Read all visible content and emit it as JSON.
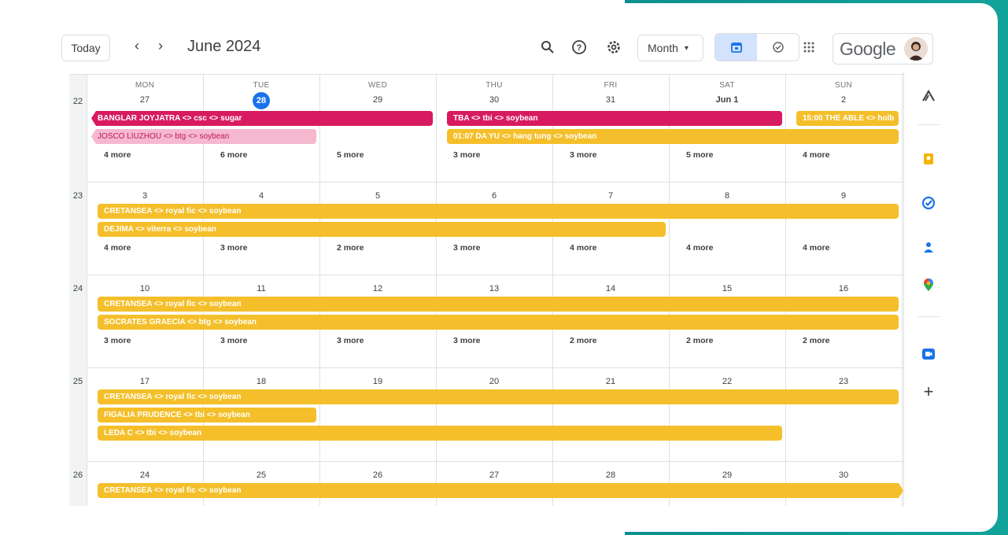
{
  "toolbar": {
    "today_label": "Today",
    "prev_icon": "chevron-left-icon",
    "prev_glyph": "‹",
    "next_icon": "chevron-right-icon",
    "next_glyph": "›",
    "month_title": "June 2024",
    "view_select": "Month",
    "view_select_caret": "▾",
    "brand": "Google"
  },
  "calendar": {
    "headers": [
      {
        "dow": "MON",
        "num": "27"
      },
      {
        "dow": "TUE",
        "num": "28"
      },
      {
        "dow": "WED",
        "num": "29"
      },
      {
        "dow": "THU",
        "num": "30"
      },
      {
        "dow": "FRI",
        "num": "31"
      },
      {
        "dow": "SAT",
        "num": "Jun 1"
      },
      {
        "dow": "SUN",
        "num": "2"
      }
    ],
    "weeks": [
      {
        "week": "22",
        "days": [
          "27",
          "28",
          "29",
          "30",
          "31",
          "Jun 1",
          "2"
        ],
        "more": [
          "4 more",
          "6 more",
          "5 more",
          "3 more",
          "3 more",
          "5 more",
          "4 more"
        ],
        "events": [
          {
            "title": "BANGLAR JOYJATRA <> csc <> sugar",
            "start": 0,
            "span": 3,
            "lane": 0,
            "color": "red"
          },
          {
            "title": "TBA <> tbi <> soybean",
            "start": 3,
            "span": 3,
            "lane": 0,
            "color": "red"
          },
          {
            "title": "15:00 THE ABLE <> holb",
            "start": 6,
            "span": 1,
            "lane": 0,
            "color": "yellow"
          },
          {
            "title": "JOSCO LIUZHOU <> btg <> soybean",
            "start": 0,
            "span": 2,
            "lane": 1,
            "color": "pink"
          },
          {
            "title": "01:07 DA YU <> hang tung <> soybean",
            "start": 3,
            "span": 4,
            "lane": 1,
            "color": "yellow"
          }
        ]
      },
      {
        "week": "23",
        "days": [
          "3",
          "4",
          "5",
          "6",
          "7",
          "8",
          "9"
        ],
        "more": [
          "4 more",
          "3 more",
          "2 more",
          "3 more",
          "4 more",
          "4 more",
          "4 more"
        ],
        "events": [
          {
            "title": "CRETANSEA <> royal fic <> soybean",
            "start": 0,
            "span": 7,
            "lane": 0,
            "color": "yellow"
          },
          {
            "title": "DEJIMA <> viterra <> soybean",
            "start": 0,
            "span": 5,
            "lane": 1,
            "color": "yellow"
          }
        ]
      },
      {
        "week": "24",
        "days": [
          "10",
          "11",
          "12",
          "13",
          "14",
          "15",
          "16"
        ],
        "more": [
          "3 more",
          "3 more",
          "3 more",
          "3 more",
          "2 more",
          "2 more",
          "2 more"
        ],
        "events": [
          {
            "title": "CRETANSEA <> royal fic <> soybean",
            "start": 0,
            "span": 7,
            "lane": 0,
            "color": "yellow"
          },
          {
            "title": "SOCRATES GRAECIA <> btg <> soybean",
            "start": 0,
            "span": 7,
            "lane": 1,
            "color": "yellow"
          }
        ]
      },
      {
        "week": "25",
        "days": [
          "17",
          "18",
          "19",
          "20",
          "21",
          "22",
          "23"
        ],
        "more": [],
        "events": [
          {
            "title": "CRETANSEA <> royal fic <> soybean",
            "start": 0,
            "span": 7,
            "lane": 0,
            "color": "yellow"
          },
          {
            "title": "FIGALIA PRUDENCE <> tbi <> soybean",
            "start": 0,
            "span": 2,
            "lane": 1,
            "color": "yellow"
          },
          {
            "title": "LEDA C <> tbi <> soybean",
            "start": 0,
            "span": 6,
            "lane": 2,
            "color": "yellow"
          }
        ]
      },
      {
        "week": "26",
        "days": [
          "24",
          "25",
          "26",
          "27",
          "28",
          "29",
          "30"
        ],
        "more": [],
        "events": [
          {
            "title": "CRETANSEA <> royal fic <> soybean",
            "start": 0,
            "span": 7,
            "lane": 0,
            "color": "yellow",
            "continues": true
          }
        ]
      }
    ]
  },
  "side_panel": {
    "icons": [
      "keep-icon",
      "tasks-icon",
      "contacts-icon",
      "maps-icon",
      "meet-icon"
    ],
    "add_label": "+"
  },
  "colors": {
    "red": "#d81b60",
    "yellow": "#f4bf2a",
    "pink": "#f5b8cf",
    "today": "#1a73e8",
    "teal": "#0d8f8f"
  }
}
